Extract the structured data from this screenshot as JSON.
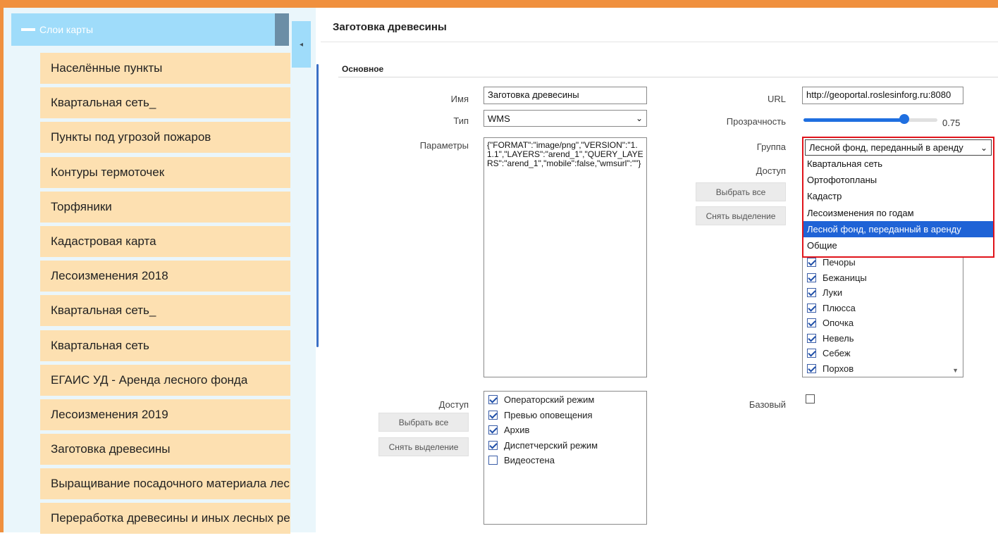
{
  "sidebar": {
    "header_title": "Слои карты",
    "collapse_icon": "◂",
    "items": [
      {
        "label": "Населённые пункты"
      },
      {
        "label": "Квартальная сеть_"
      },
      {
        "label": "Пункты под угрозой пожаров"
      },
      {
        "label": "Контуры термоточек"
      },
      {
        "label": "Торфяники"
      },
      {
        "label": "Кадастровая карта"
      },
      {
        "label": "Лесоизменения 2018"
      },
      {
        "label": "Квартальная сеть_"
      },
      {
        "label": "Квартальная сеть"
      },
      {
        "label": "ЕГАИС УД - Аренда лесного фонда"
      },
      {
        "label": "Лесоизменения 2019"
      },
      {
        "label": "Заготовка древесины"
      },
      {
        "label": "Выращивание посадочного материала лесных растений"
      },
      {
        "label": "Переработка древесины и иных лесных ресурсов"
      }
    ]
  },
  "main": {
    "title": "Заготовка древесины",
    "section_title": "Основное",
    "form": {
      "name_label": "Имя",
      "name_value": "Заготовка древесины",
      "type_label": "Тип",
      "type_value": "WMS",
      "params_label": "Параметры",
      "params_value": "{\"FORMAT\":\"image/png\",\"VERSION\":\"1.1.1\",\"LAYERS\":\"arend_1\",\"QUERY_LAYERS\":\"arend_1\",\"mobile\":false,\"wmsurl\":\"\"}",
      "url_label": "URL",
      "url_value": "http://geoportal.roslesinforg.ru:8080",
      "opacity_label": "Прозрачность",
      "opacity_value": "0.75",
      "opacity_fraction": 0.75,
      "group_label": "Группа",
      "group_selected": "Лесной фонд, переданный в аренду",
      "group_options": [
        {
          "label": "Квартальная сеть"
        },
        {
          "label": "Ортофотопланы"
        },
        {
          "label": "Кадастр"
        },
        {
          "label": "Лесоизменения по годам"
        },
        {
          "label": "Лесной фонд, переданный в аренду"
        },
        {
          "label": "Общие"
        }
      ],
      "access_label_right": "Доступ",
      "select_all": "Выбрать все",
      "deselect": "Снять выделение",
      "regions": [
        {
          "label": "Печоры",
          "checked": true
        },
        {
          "label": "Бежаницы",
          "checked": true
        },
        {
          "label": "Луки",
          "checked": true
        },
        {
          "label": "Плюсса",
          "checked": true
        },
        {
          "label": "Опочка",
          "checked": true
        },
        {
          "label": "Невель",
          "checked": true
        },
        {
          "label": "Себеж",
          "checked": true
        },
        {
          "label": "Порхов",
          "checked": true
        }
      ],
      "access_label_left": "Доступ",
      "modes": [
        {
          "label": "Операторский режим",
          "checked": true
        },
        {
          "label": "Превью оповещения",
          "checked": true
        },
        {
          "label": "Архив",
          "checked": true
        },
        {
          "label": "Диспетчерский режим",
          "checked": true
        },
        {
          "label": "Видеостена",
          "checked": false
        }
      ],
      "base_label": "Базовый",
      "base_checked": false
    }
  },
  "colors": {
    "frame": "#f0903e",
    "sidebar_header": "#9fdcfa",
    "layer_item": "#fde0b1",
    "accent": "#1f6fe0",
    "dropdown_border": "#e0141b"
  }
}
